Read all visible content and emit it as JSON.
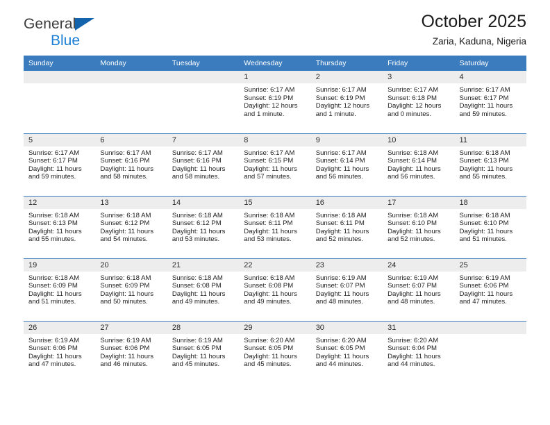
{
  "brand": {
    "name_top": "General",
    "name_bottom": "Blue",
    "accent_color": "#1a7fd4",
    "triangle_color": "#1463ad"
  },
  "header": {
    "title": "October 2025",
    "location": "Zaria, Kaduna, Nigeria",
    "header_bg_color": "#3a7cbe",
    "daynum_bg_color": "#ededed"
  },
  "weekday_headers": [
    "Sunday",
    "Monday",
    "Tuesday",
    "Wednesday",
    "Thursday",
    "Friday",
    "Saturday"
  ],
  "labels": {
    "sunrise_prefix": "Sunrise:",
    "sunset_prefix": "Sunset:",
    "daylight_prefix": "Daylight:"
  },
  "weeks": [
    [
      {
        "day": "",
        "sunrise": "",
        "sunset": "",
        "daylight": "",
        "empty": true
      },
      {
        "day": "",
        "sunrise": "",
        "sunset": "",
        "daylight": "",
        "empty": true
      },
      {
        "day": "",
        "sunrise": "",
        "sunset": "",
        "daylight": "",
        "empty": true
      },
      {
        "day": "1",
        "sunrise": "Sunrise: 6:17 AM",
        "sunset": "Sunset: 6:19 PM",
        "daylight": "Daylight: 12 hours and 1 minute."
      },
      {
        "day": "2",
        "sunrise": "Sunrise: 6:17 AM",
        "sunset": "Sunset: 6:19 PM",
        "daylight": "Daylight: 12 hours and 1 minute."
      },
      {
        "day": "3",
        "sunrise": "Sunrise: 6:17 AM",
        "sunset": "Sunset: 6:18 PM",
        "daylight": "Daylight: 12 hours and 0 minutes."
      },
      {
        "day": "4",
        "sunrise": "Sunrise: 6:17 AM",
        "sunset": "Sunset: 6:17 PM",
        "daylight": "Daylight: 11 hours and 59 minutes."
      }
    ],
    [
      {
        "day": "5",
        "sunrise": "Sunrise: 6:17 AM",
        "sunset": "Sunset: 6:17 PM",
        "daylight": "Daylight: 11 hours and 59 minutes."
      },
      {
        "day": "6",
        "sunrise": "Sunrise: 6:17 AM",
        "sunset": "Sunset: 6:16 PM",
        "daylight": "Daylight: 11 hours and 58 minutes."
      },
      {
        "day": "7",
        "sunrise": "Sunrise: 6:17 AM",
        "sunset": "Sunset: 6:16 PM",
        "daylight": "Daylight: 11 hours and 58 minutes."
      },
      {
        "day": "8",
        "sunrise": "Sunrise: 6:17 AM",
        "sunset": "Sunset: 6:15 PM",
        "daylight": "Daylight: 11 hours and 57 minutes."
      },
      {
        "day": "9",
        "sunrise": "Sunrise: 6:17 AM",
        "sunset": "Sunset: 6:14 PM",
        "daylight": "Daylight: 11 hours and 56 minutes."
      },
      {
        "day": "10",
        "sunrise": "Sunrise: 6:18 AM",
        "sunset": "Sunset: 6:14 PM",
        "daylight": "Daylight: 11 hours and 56 minutes."
      },
      {
        "day": "11",
        "sunrise": "Sunrise: 6:18 AM",
        "sunset": "Sunset: 6:13 PM",
        "daylight": "Daylight: 11 hours and 55 minutes."
      }
    ],
    [
      {
        "day": "12",
        "sunrise": "Sunrise: 6:18 AM",
        "sunset": "Sunset: 6:13 PM",
        "daylight": "Daylight: 11 hours and 55 minutes."
      },
      {
        "day": "13",
        "sunrise": "Sunrise: 6:18 AM",
        "sunset": "Sunset: 6:12 PM",
        "daylight": "Daylight: 11 hours and 54 minutes."
      },
      {
        "day": "14",
        "sunrise": "Sunrise: 6:18 AM",
        "sunset": "Sunset: 6:12 PM",
        "daylight": "Daylight: 11 hours and 53 minutes."
      },
      {
        "day": "15",
        "sunrise": "Sunrise: 6:18 AM",
        "sunset": "Sunset: 6:11 PM",
        "daylight": "Daylight: 11 hours and 53 minutes."
      },
      {
        "day": "16",
        "sunrise": "Sunrise: 6:18 AM",
        "sunset": "Sunset: 6:11 PM",
        "daylight": "Daylight: 11 hours and 52 minutes."
      },
      {
        "day": "17",
        "sunrise": "Sunrise: 6:18 AM",
        "sunset": "Sunset: 6:10 PM",
        "daylight": "Daylight: 11 hours and 52 minutes."
      },
      {
        "day": "18",
        "sunrise": "Sunrise: 6:18 AM",
        "sunset": "Sunset: 6:10 PM",
        "daylight": "Daylight: 11 hours and 51 minutes."
      }
    ],
    [
      {
        "day": "19",
        "sunrise": "Sunrise: 6:18 AM",
        "sunset": "Sunset: 6:09 PM",
        "daylight": "Daylight: 11 hours and 51 minutes."
      },
      {
        "day": "20",
        "sunrise": "Sunrise: 6:18 AM",
        "sunset": "Sunset: 6:09 PM",
        "daylight": "Daylight: 11 hours and 50 minutes."
      },
      {
        "day": "21",
        "sunrise": "Sunrise: 6:18 AM",
        "sunset": "Sunset: 6:08 PM",
        "daylight": "Daylight: 11 hours and 49 minutes."
      },
      {
        "day": "22",
        "sunrise": "Sunrise: 6:18 AM",
        "sunset": "Sunset: 6:08 PM",
        "daylight": "Daylight: 11 hours and 49 minutes."
      },
      {
        "day": "23",
        "sunrise": "Sunrise: 6:19 AM",
        "sunset": "Sunset: 6:07 PM",
        "daylight": "Daylight: 11 hours and 48 minutes."
      },
      {
        "day": "24",
        "sunrise": "Sunrise: 6:19 AM",
        "sunset": "Sunset: 6:07 PM",
        "daylight": "Daylight: 11 hours and 48 minutes."
      },
      {
        "day": "25",
        "sunrise": "Sunrise: 6:19 AM",
        "sunset": "Sunset: 6:06 PM",
        "daylight": "Daylight: 11 hours and 47 minutes."
      }
    ],
    [
      {
        "day": "26",
        "sunrise": "Sunrise: 6:19 AM",
        "sunset": "Sunset: 6:06 PM",
        "daylight": "Daylight: 11 hours and 47 minutes."
      },
      {
        "day": "27",
        "sunrise": "Sunrise: 6:19 AM",
        "sunset": "Sunset: 6:06 PM",
        "daylight": "Daylight: 11 hours and 46 minutes."
      },
      {
        "day": "28",
        "sunrise": "Sunrise: 6:19 AM",
        "sunset": "Sunset: 6:05 PM",
        "daylight": "Daylight: 11 hours and 45 minutes."
      },
      {
        "day": "29",
        "sunrise": "Sunrise: 6:20 AM",
        "sunset": "Sunset: 6:05 PM",
        "daylight": "Daylight: 11 hours and 45 minutes."
      },
      {
        "day": "30",
        "sunrise": "Sunrise: 6:20 AM",
        "sunset": "Sunset: 6:05 PM",
        "daylight": "Daylight: 11 hours and 44 minutes."
      },
      {
        "day": "31",
        "sunrise": "Sunrise: 6:20 AM",
        "sunset": "Sunset: 6:04 PM",
        "daylight": "Daylight: 11 hours and 44 minutes."
      },
      {
        "day": "",
        "sunrise": "",
        "sunset": "",
        "daylight": "",
        "empty": true
      }
    ]
  ]
}
